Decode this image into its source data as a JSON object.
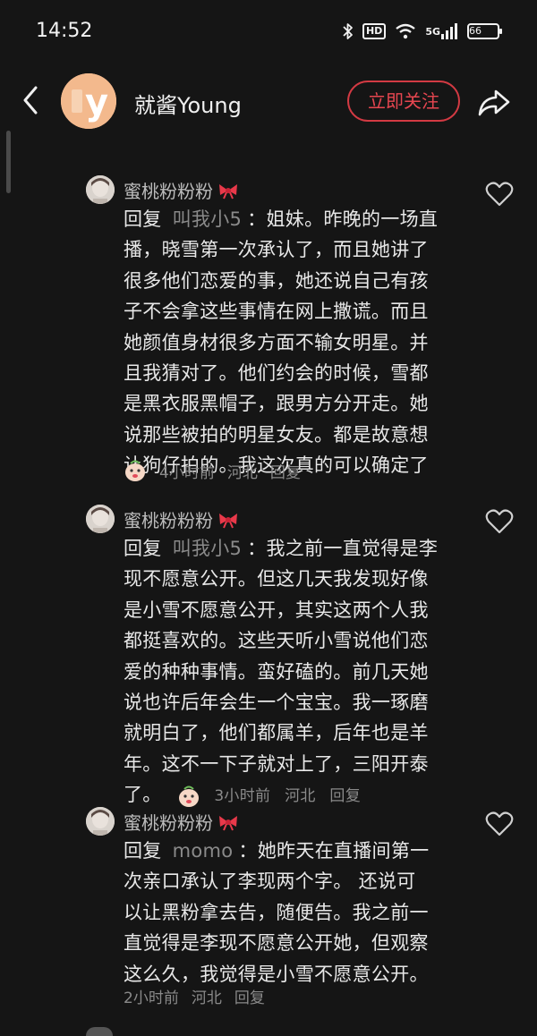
{
  "status_bar": {
    "time": "14:52",
    "icons": [
      "bluetooth-icon",
      "hd-icon",
      "wifi-icon",
      "5g-signal-icon",
      "battery-icon"
    ],
    "hd_label": "HD",
    "network_label": "5G",
    "battery": "66"
  },
  "header": {
    "avatar_letter": "y",
    "username": "就酱Young",
    "follow_label": "立即关注",
    "accent_color": "#e64650"
  },
  "comments": [
    {
      "author": "蜜桃粉粉粉",
      "reply_label": "回复",
      "reply_to": "叫我小5",
      "lines": [
        "姐妹。昨晚的一场直",
        "播，晓雪第一次承认了，而且她讲了",
        "很多他们恋爱的事，她还说自己有孩",
        "子不会拿这些事情在网上撒谎。而且",
        "她颜值身材很多方面不输女明星。并",
        "且我猜对了。他们约会的时候，雪都",
        "是黑衣服黑帽子，跟男方分开走。她",
        "说那些被拍的明星女友。都是故意想",
        "让狗仔拍的。我这次真的可以确定了"
      ],
      "time": "4小时前",
      "location": "河北",
      "reply_action": "回复"
    },
    {
      "author": "蜜桃粉粉粉",
      "reply_label": "回复",
      "reply_to": "叫我小5",
      "lines": [
        "我之前一直觉得是李",
        "现不愿意公开。但这几天我发现好像",
        "是小雪不愿意公开，其实这两个人我",
        "都挺喜欢的。这些天听小雪说他们恋",
        "爱的种种事情。蛮好磕的。前几天她",
        "说也许后年会生一个宝宝。我一琢磨",
        "就明白了，他们都属羊，后年也是羊",
        "年。这不一下子就对上了，三阳开泰",
        "了。"
      ],
      "time": "3小时前",
      "location": "河北",
      "reply_action": "回复"
    },
    {
      "author": "蜜桃粉粉粉",
      "reply_label": "回复",
      "reply_to": "momo",
      "lines": [
        "她昨天在直播间第一",
        "次亲口承认了李现两个字。 还说可",
        "以让黑粉拿去告，随便告。我之前一",
        "直觉得是李现不愿意公开她，但观察",
        "这么久，我觉得是小雪不愿意公开。"
      ],
      "time": "2小时前",
      "location": "河北",
      "reply_action": "回复"
    }
  ]
}
